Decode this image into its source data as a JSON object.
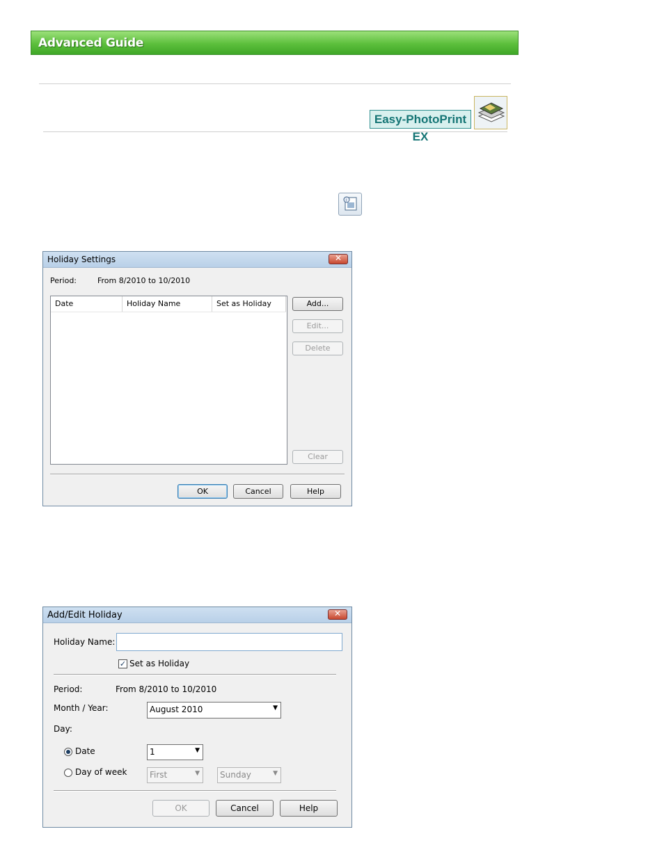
{
  "header": {
    "banner": "Advanced Guide",
    "product_badge": "Easy-PhotoPrint EX"
  },
  "holiday_settings": {
    "title": "Holiday Settings",
    "period_label": "Period:",
    "period_value": "From 8/2010 to 10/2010",
    "columns": [
      "Date",
      "Holiday Name",
      "Set as Holiday"
    ],
    "buttons": {
      "add": "Add...",
      "edit": "Edit...",
      "delete": "Delete",
      "clear": "Clear",
      "ok": "OK",
      "cancel": "Cancel",
      "help": "Help"
    }
  },
  "add_edit_holiday": {
    "title": "Add/Edit Holiday",
    "holiday_name_label": "Holiday Name:",
    "holiday_name_value": "",
    "set_as_holiday_label": "Set as Holiday",
    "set_as_holiday_checked": true,
    "period_label": "Period:",
    "period_value": "From 8/2010 to 10/2010",
    "month_year_label": "Month / Year:",
    "month_year_value": "August 2010",
    "day_label": "Day:",
    "date_radio_label": "Date",
    "date_value": "1",
    "day_of_week_radio_label": "Day of week",
    "week_value": "First",
    "weekday_value": "Sunday",
    "selected_day_mode": "Date",
    "buttons": {
      "ok": "OK",
      "cancel": "Cancel",
      "help": "Help"
    }
  }
}
